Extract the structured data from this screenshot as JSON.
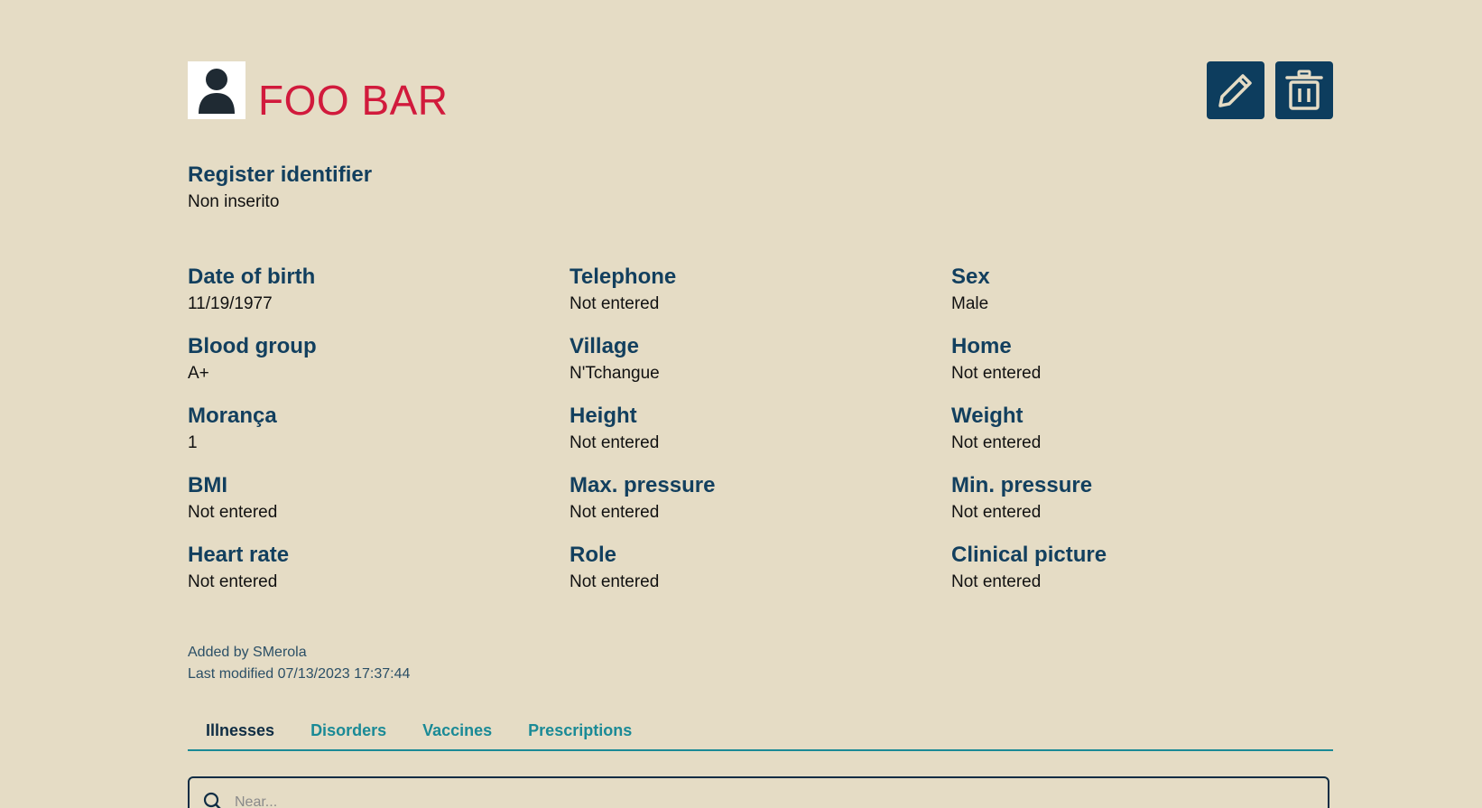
{
  "patient": {
    "name": "FOO BAR"
  },
  "actions": {
    "edit_icon": "pencil-icon",
    "delete_icon": "trash-icon"
  },
  "register": {
    "label": "Register identifier",
    "value": "Non inserito"
  },
  "fields": [
    {
      "label": "Date of birth",
      "value": "11/19/1977"
    },
    {
      "label": "Telephone",
      "value": "Not entered"
    },
    {
      "label": "Sex",
      "value": "Male"
    },
    {
      "label": "Blood group",
      "value": "A+"
    },
    {
      "label": "Village",
      "value": "N'Tchangue"
    },
    {
      "label": "Home",
      "value": "Not entered"
    },
    {
      "label": "Morança",
      "value": "1"
    },
    {
      "label": "Height",
      "value": "Not entered"
    },
    {
      "label": "Weight",
      "value": "Not entered"
    },
    {
      "label": "BMI",
      "value": "Not entered"
    },
    {
      "label": "Max. pressure",
      "value": "Not entered"
    },
    {
      "label": "Min. pressure",
      "value": "Not entered"
    },
    {
      "label": "Heart rate",
      "value": "Not entered"
    },
    {
      "label": "Role",
      "value": "Not entered"
    },
    {
      "label": "Clinical picture",
      "value": "Not entered"
    }
  ],
  "meta": {
    "added_by": "Added by SMerola",
    "last_modified": "Last modified 07/13/2023 17:37:44"
  },
  "tabs": [
    {
      "label": "Illnesses",
      "active": true
    },
    {
      "label": "Disorders",
      "active": false
    },
    {
      "label": "Vaccines",
      "active": false
    },
    {
      "label": "Prescriptions",
      "active": false
    }
  ],
  "search": {
    "placeholder": "Near..."
  },
  "colors": {
    "background": "#e5dcc5",
    "name": "#d11a3c",
    "label": "#123f5e",
    "button": "#0d3d5e",
    "tab_accent": "#1a8a96"
  }
}
